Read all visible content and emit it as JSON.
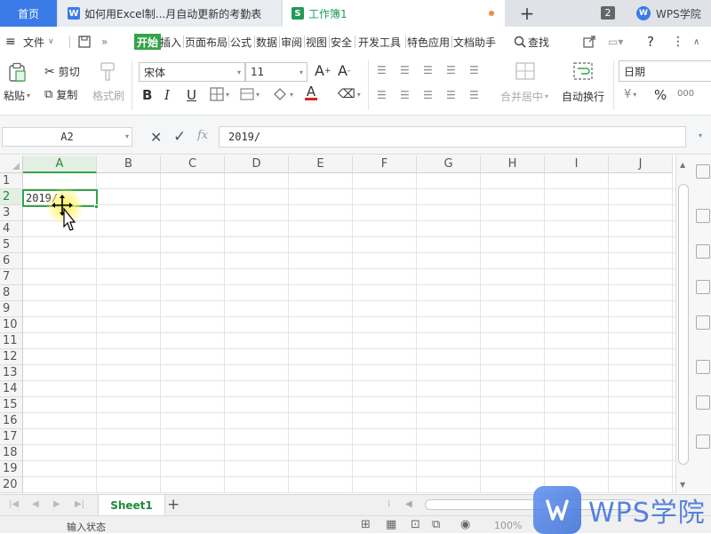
{
  "tabs": {
    "home": "首页",
    "doc": "如何用Excel制...月自动更新的考勤表",
    "book": "工作簿1",
    "window_count": "2",
    "academy": "WPS学院"
  },
  "menu": {
    "file": "文件",
    "items": [
      "开始",
      "插入",
      "页面布局",
      "公式",
      "数据",
      "审阅",
      "视图",
      "安全",
      "开发工具",
      "特色应用",
      "文档助手"
    ],
    "search": "查找"
  },
  "ribbon": {
    "paste": "粘贴",
    "cut": "剪切",
    "copy": "复制",
    "format_painter": "格式刷",
    "font_name": "宋体",
    "font_size": "11",
    "bold": "B",
    "italic": "I",
    "underline": "U",
    "font_color_glyph": "A",
    "merge_center": "合并居中",
    "wrap_text": "自动换行",
    "number_format": "日期",
    "percent": "%",
    "thousands": "000"
  },
  "formula_bar": {
    "name_box": "A2",
    "cancel": "✕",
    "confirm": "✓",
    "fx": "fx",
    "content": "2019/"
  },
  "grid": {
    "columns": [
      "A",
      "B",
      "C",
      "D",
      "E",
      "F",
      "G",
      "H",
      "I",
      "J"
    ],
    "rows": [
      "1",
      "2",
      "3",
      "4",
      "5",
      "6",
      "7",
      "8",
      "9",
      "10",
      "11",
      "12",
      "13",
      "14",
      "15",
      "16",
      "17",
      "18",
      "19",
      "20"
    ],
    "active_cell_value": "2019/"
  },
  "sheets": {
    "active": "Sheet1",
    "add": "+"
  },
  "status": {
    "mode": "输入状态",
    "zoom": "100%"
  },
  "watermark": {
    "text": "WPS学院"
  },
  "colors": {
    "accent_green": "#35a34a",
    "tab_blue": "#3b7be8"
  }
}
